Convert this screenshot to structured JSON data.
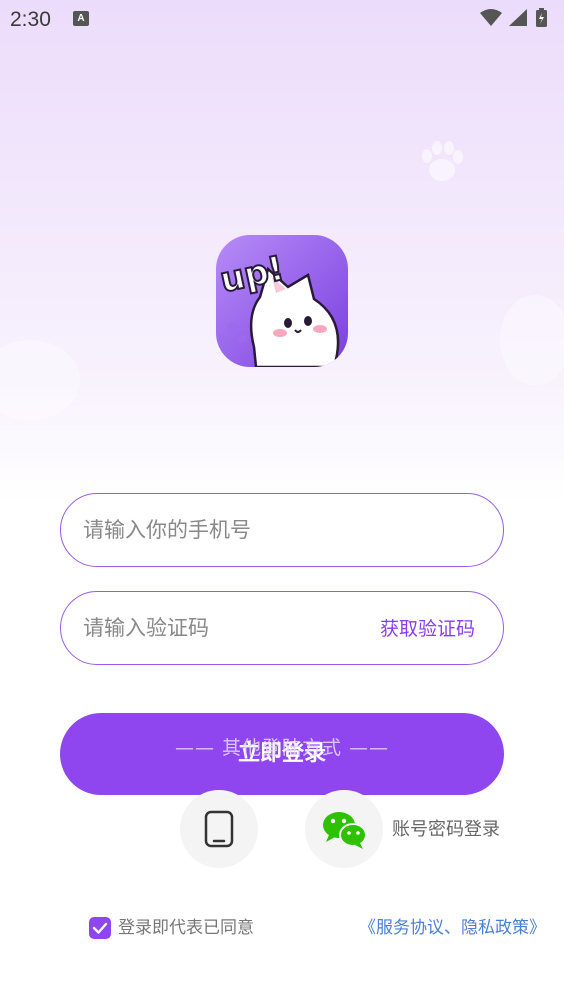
{
  "status_bar": {
    "time": "2:30",
    "notification_icon": "a-letter-icon",
    "icons": [
      "wifi-icon",
      "signal-icon",
      "battery-icon"
    ]
  },
  "logo": {
    "text": "up!",
    "icon": "cat-mascot-icon"
  },
  "phone_field": {
    "placeholder": "请输入你的手机号",
    "value": ""
  },
  "code_field": {
    "placeholder": "请输入验证码",
    "value": "",
    "get_code_label": "获取验证码"
  },
  "login_button": {
    "label": "立即登录"
  },
  "other_login": {
    "label": "—— 其他登陆方式 ——",
    "phone_icon": "phone-icon",
    "wechat_icon": "wechat-icon",
    "account_label": "账号密码登录"
  },
  "agreement": {
    "checked": true,
    "text": "登录即代表已同意",
    "link": "《服务协议、隐私政策》"
  },
  "colors": {
    "accent": "#8f46ee",
    "link": "#4a7fd6",
    "wechat": "#2dc100"
  }
}
